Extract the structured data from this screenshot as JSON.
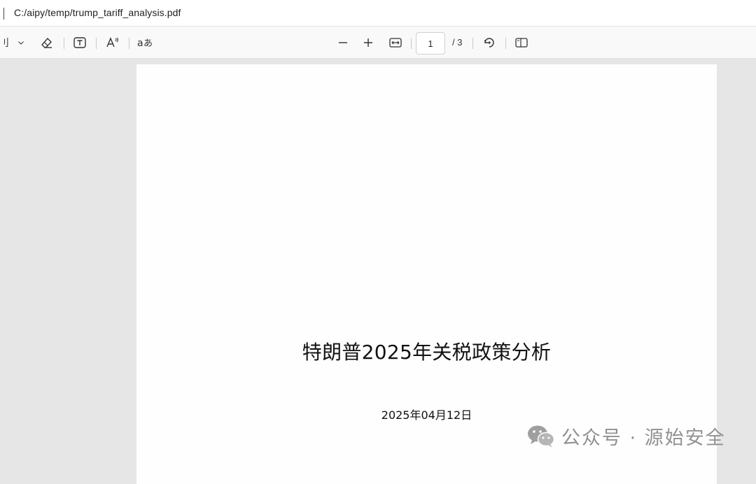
{
  "address_bar": {
    "path": "C:/aipy/temp/trump_tariff_analysis.pdf"
  },
  "toolbar": {
    "draw_label_partial": "刂",
    "draw_dropdown_icon": "chevron-down-icon",
    "erase_icon": "eraser-icon",
    "text_icon": "text-box-icon",
    "read_aloud_icon": "read-aloud-icon",
    "translate_icon": "translate-icon",
    "zoom_out_icon": "minus-icon",
    "zoom_in_icon": "plus-icon",
    "fit_icon": "fit-width-icon",
    "page_current": "1",
    "page_total": "/ 3",
    "rotate_icon": "rotate-icon",
    "page_view_icon": "page-view-icon"
  },
  "document": {
    "title": "特朗普2025年关税政策分析",
    "date": "2025年04月12日"
  },
  "watermark": {
    "text": "公众号 · 源始安全"
  },
  "colors": {
    "toolbar_bg": "#f9f9f9",
    "viewer_bg": "#e6e6e6",
    "page_bg": "#fefefe",
    "watermark": "#8c8c8c"
  }
}
